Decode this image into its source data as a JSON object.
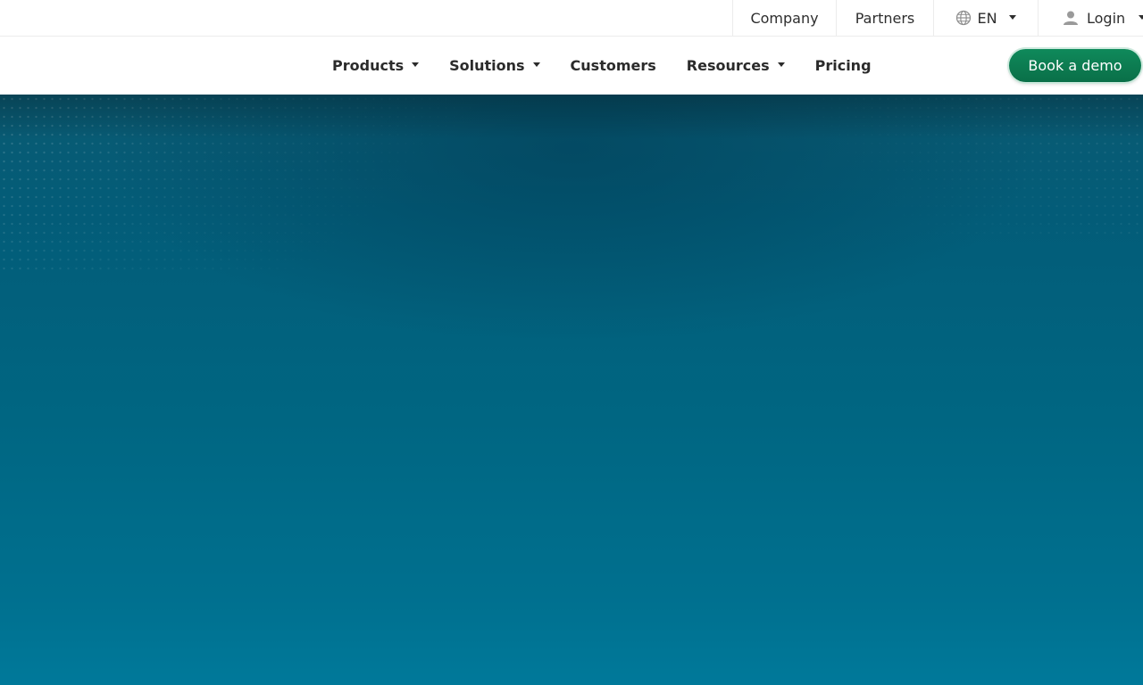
{
  "utility_nav": {
    "company": "Company",
    "partners": "Partners",
    "language": "EN",
    "login": "Login"
  },
  "main_nav": {
    "items": [
      {
        "label": "Products",
        "has_dropdown": true
      },
      {
        "label": "Solutions",
        "has_dropdown": true
      },
      {
        "label": "Customers",
        "has_dropdown": false
      },
      {
        "label": "Resources",
        "has_dropdown": true
      },
      {
        "label": "Pricing",
        "has_dropdown": false
      }
    ],
    "cta_label": "Book a demo"
  },
  "icons": {
    "language": "globe-icon",
    "login": "user-icon",
    "dropdown": "caret-down-icon"
  },
  "colors": {
    "cta": "#0a7a50",
    "hero_top": "#035c78",
    "hero_bottom": "#00799a",
    "nav_text": "#2b2b2b"
  }
}
